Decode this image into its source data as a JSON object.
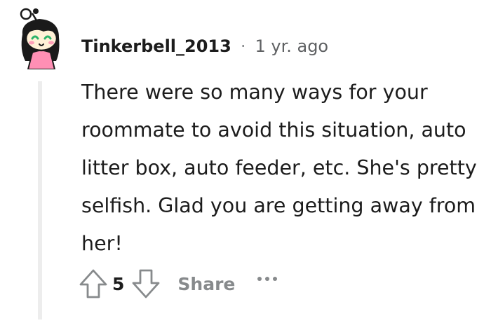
{
  "comment": {
    "username": "Tinkerbell_2013",
    "separator": "·",
    "timestamp": "1 yr. ago",
    "body": "There were so many ways for your roommate to avoid this situation, auto litter box, auto feeder, etc. She's pretty selfish. Glad you are getting away from her!",
    "score": "5",
    "share_label": "Share",
    "avatar_icon": "snoo-avatar-icon",
    "upvote_icon": "arrow-up-outline-icon",
    "downvote_icon": "arrow-down-outline-icon",
    "more_icon": "ellipsis-icon"
  },
  "colors": {
    "text": "#1c1c1c",
    "muted": "#878a8c",
    "thread_line": "#ededed",
    "avatar_skin": "#fff1d6",
    "avatar_hair": "#1a1a1a",
    "avatar_dress": "#ff8fb4"
  }
}
